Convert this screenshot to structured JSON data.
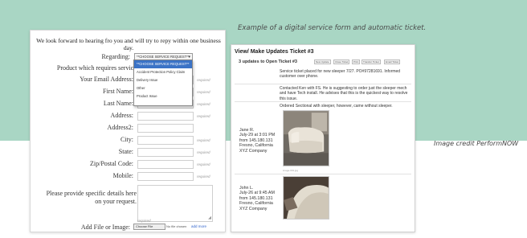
{
  "caption": "Example of a digital service form and automatic ticket.",
  "credit": "Image credit PerformNOW",
  "form": {
    "intro": "We look forward to hearing fro you and will try to repy within one business day.",
    "regarding_label": "Regarding:",
    "regarding_value": "**CHOOSE SERVICE REQUEST**",
    "dropdown_options": [
      "**CHOOSE SERVICE REQUEST**",
      "Accident Protection Policy Claim",
      "Delivery Issue",
      "Other",
      "Product Issue"
    ],
    "fields": [
      {
        "label": "Product which requires service:",
        "required": "required"
      },
      {
        "label": "Your Email Address:",
        "required": "required"
      },
      {
        "label": "First Name:",
        "required": "required"
      },
      {
        "label": "Last Name:",
        "required": "required"
      },
      {
        "label": "Address:",
        "required": "required"
      },
      {
        "label": "Address2:",
        "required": ""
      },
      {
        "label": "City:",
        "required": "required"
      },
      {
        "label": "State:",
        "required": "required"
      },
      {
        "label": "Zip/Postal Code:",
        "required": "required"
      },
      {
        "label": "Mobile:",
        "required": "required"
      }
    ],
    "details_label": "Please provide specific details here on your request.",
    "details_required": "required",
    "file_label": "Add File or Image:",
    "file_button": "Choose File",
    "file_status": "No file chosen",
    "add_more": "add more"
  },
  "ticket": {
    "title": "View/ Make Updates Ticket #3",
    "subtitle": "3 updates to Open Ticket #3",
    "buttons": [
      "New Update",
      "Close Ticket",
      "Print",
      "Transfer Ticket",
      "Email Ticket"
    ],
    "updates": [
      {
        "author": "",
        "text": "Service ticket placed for new sleeper 7/27. PO#97281691. Informed customer over phone."
      },
      {
        "author": "",
        "text": "Contacted Ken with FS. He is suggesting to order just the sleeper mech and have Tech install. He advises that this is the quickest way to resolve this issue."
      },
      {
        "author": "Jane R.\nJuly-29 at 3:01 PM\nfrom 145.180.131\nFresno, California\nXYZ Company",
        "text": "Ordered Sectional with sleeper, however, came without sleeper.",
        "photo_caption": "image-001.jpg"
      },
      {
        "author": "John L.\nJuly-26 at 9:45 AM\nfrom 145.180.131\nFresno, California\nXYZ Company",
        "text": ""
      }
    ]
  }
}
